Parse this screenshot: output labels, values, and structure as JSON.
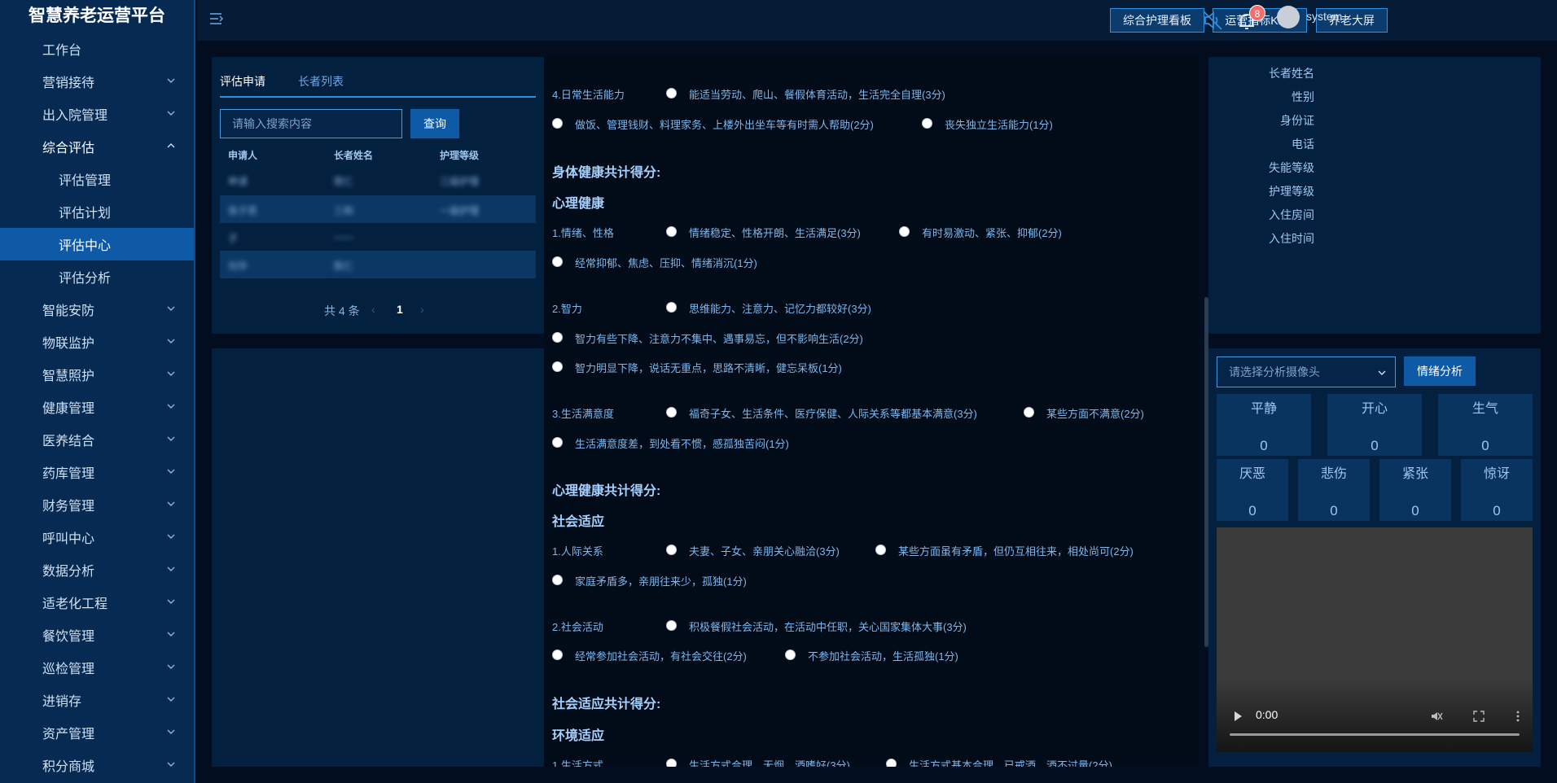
{
  "app": {
    "title": "智慧养老运营平台"
  },
  "sidebar": {
    "items": [
      {
        "label": "工作台"
      },
      {
        "label": "营销接待"
      },
      {
        "label": "出入院管理"
      },
      {
        "label": "综合评估"
      },
      {
        "label": "评估管理"
      },
      {
        "label": "评估计划"
      },
      {
        "label": "评估中心"
      },
      {
        "label": "评估分析"
      },
      {
        "label": "智能安防"
      },
      {
        "label": "物联监护"
      },
      {
        "label": "智慧照护"
      },
      {
        "label": "健康管理"
      },
      {
        "label": "医养结合"
      },
      {
        "label": "药库管理"
      },
      {
        "label": "财务管理"
      },
      {
        "label": "呼叫中心"
      },
      {
        "label": "数据分析"
      },
      {
        "label": "适老化工程"
      },
      {
        "label": "餐饮管理"
      },
      {
        "label": "巡检管理"
      },
      {
        "label": "进销存"
      },
      {
        "label": "资产管理"
      },
      {
        "label": "积分商城"
      }
    ]
  },
  "header": {
    "btn_care_board": "综合护理看板",
    "btn_kpis": "运营指标KPIs",
    "btn_big_screen": "养老大屏",
    "notification_count": "8",
    "username": "system"
  },
  "left": {
    "tabs": [
      "评估申请",
      "长者列表"
    ],
    "search_placeholder": "请输入搜索内容",
    "query_label": "查询",
    "columns": [
      "申请人",
      "长者姓名",
      "护理等级"
    ],
    "rows": [
      [
        "申请",
        "陈仁",
        "三级护理"
      ],
      [
        "张子思",
        "三和",
        "一级护理"
      ],
      [
        "子",
        "——",
        ""
      ],
      [
        "刘华",
        "陈仁",
        ""
      ]
    ],
    "pager": {
      "total": "共 4 条",
      "page": "1"
    }
  },
  "middle": {
    "q4": {
      "label": "4.日常生活能力",
      "opt1": "能适当劳动、爬山、餐假体育活动，生活完全自理(3分)",
      "opt2": "做饭、管理钱财、料理家务、上楼外出坐车等有时需人帮助(2分)",
      "opt3": "丧失独立生活能力(1分)"
    },
    "physical_total": "身体健康共计得分:",
    "mental_title": "心理健康",
    "m1": {
      "label": "1.情绪、性格",
      "opt1": "情绪稳定、性格开朗、生活满足(3分)",
      "opt2": "有时易激动、紧张、抑郁(2分)",
      "opt3": "经常抑郁、焦虑、压抑、情绪消沉(1分)"
    },
    "m2": {
      "label": "2.智力",
      "opt1": "思维能力、注意力、记忆力都较好(3分)",
      "opt2": "智力有些下降、注意力不集中、遇事易忘，但不影响生活(2分)",
      "opt3": "智力明显下降，说话无重点，思路不清晰，健忘呆板(1分)"
    },
    "m3": {
      "label": "3.生活满意度",
      "opt1": "福奇子女、生活条件、医疗保健、人际关系等都基本满意(3分)",
      "opt2": "某些方面不满意(2分)",
      "opt3": "生活满意度差，到处看不惯，感孤独苦闷(1分)"
    },
    "mental_total": "心理健康共计得分:",
    "social_title": "社会适应",
    "s1": {
      "label": "1.人际关系",
      "opt1": "夫妻、子女、亲朋关心融洽(3分)",
      "opt2": "某些方面虽有矛盾，但仍互相往来，相处尚可(2分)",
      "opt3": "家庭矛盾多，亲朋往来少，孤独(1分)"
    },
    "s2": {
      "label": "2.社会活动",
      "opt1": "积极餐假社会活动，在活动中任职，关心国家集体大事(3分)",
      "opt2": "经常参加社会活动，有社会交往(2分)",
      "opt3": "不参加社会活动，生活孤独(1分)"
    },
    "social_total": "社会适应共计得分:",
    "env_title": "环境适应",
    "e1": {
      "label": "1.生活方式",
      "opt1": "生活方式合理，无烟、酒嗜好(3分)",
      "opt2": "生活方式基本合理，已戒酒，酒不过量(2分)"
    }
  },
  "right": {
    "labels": [
      "长者姓名",
      "性别",
      "身份证",
      "电话",
      "失能等级",
      "护理等级",
      "入住房间",
      "入住时间"
    ],
    "camera_placeholder": "请选择分析摄像头",
    "emotion_btn": "情绪分析",
    "emotions_top": [
      {
        "name": "平静",
        "value": "0"
      },
      {
        "name": "开心",
        "value": "0"
      },
      {
        "name": "生气",
        "value": "0"
      }
    ],
    "emotions_bottom": [
      {
        "name": "厌恶",
        "value": "0"
      },
      {
        "name": "悲伤",
        "value": "0"
      },
      {
        "name": "紧张",
        "value": "0"
      },
      {
        "name": "惊讶",
        "value": "0"
      }
    ],
    "video_time": "0:00"
  }
}
